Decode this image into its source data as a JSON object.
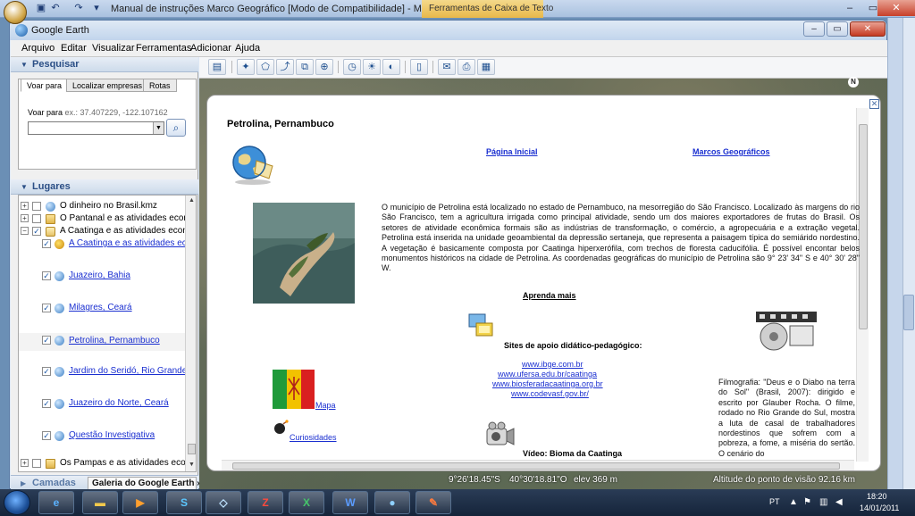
{
  "word": {
    "title": "Manual de instruções Marco Geográfico [Modo de Compatibilidade] - Microsoft Wo...",
    "tools_tab": "Ferramentas de Caixa de Texto"
  },
  "ge": {
    "title": "Google Earth",
    "menu": [
      "Arquivo",
      "Editar",
      "Visualizar",
      "Ferramentas",
      "Adicionar",
      "Ajuda"
    ]
  },
  "search": {
    "header": "Pesquisar",
    "tabs": [
      "Voar para",
      "Localizar empresas",
      "Rotas"
    ],
    "fly_label": "Voar para",
    "fly_example": "ex.: 37.407229, -122.107162",
    "input_value": ""
  },
  "places": {
    "header": "Lugares",
    "items": [
      {
        "label": "O dinheiro no Brasil.kmz"
      },
      {
        "label": "O Pantanal e as atividades econ..."
      },
      {
        "label": "A Caatinga e as atividades econ..."
      },
      {
        "label": "A Caatinga e as atividades econô"
      },
      {
        "label": "Juazeiro, Bahia"
      },
      {
        "label": "Milagres, Ceará"
      },
      {
        "label": "Petrolina, Pernambuco"
      },
      {
        "label": "Jardim do Seridó, Rio Grande do"
      },
      {
        "label": "Juazeiro do Norte, Ceará"
      },
      {
        "label": "Questão Investigativa"
      },
      {
        "label": "Os Pampas e as atividades econ..."
      }
    ]
  },
  "layers": {
    "header": "Camadas",
    "gallery": "Galeria do Google Earth  »"
  },
  "balloon": {
    "title": "Petrolina, Pernambuco",
    "home_link": "Página Inicial",
    "markers_link": "Marcos Geográficos",
    "paragraph": "O município de Petrolina está localizado no estado de Pernambuco, na mesorregião do São Francisco. Localizado às margens do rio São Francisco, tem a agricultura irrigada como principal atividade, sendo um dos maiores exportadores de frutas do Brasil. Os setores de atividade econômica formais são as indústrias de transformação, o comércio, a agropecuária e a extração vegetal. Petrolina está inserida na unidade geoambiental da depressão sertaneja, que representa a paisagem típica do semiárido nordestino. A vegetação é basicamente composta por Caatinga hiperxerófila, com trechos de floresta caducifólia. É possível encontar belos monumentos históricos na cidade de Petrolina. As coordenadas geográficas do município de Petrolina são 9° 23' 34\" S e 40° 30' 28\" W.",
    "learn_more": "Aprenda mais",
    "sites_header": "Sites de apoio didático-pedagógico:",
    "sites": [
      "www.ibge.com.br",
      "www.ufersa.edu.br/caatinga",
      "www.biosferadacaatinga.org.br",
      "www.codevasf.gov.br/"
    ],
    "film_text": "Filmografia: \"Deus e o Diabo na terra do Sol\" (Brasil, 2007): dirigido e escrito por Glauber Rocha. O filme, rodado no Rio Grande do Sul, mostra a luta de casal de trabalhadores nordestinos que sofrem com a pobreza, a fome, a miséria do sertão. O cenário do",
    "map_link": "Mapa",
    "curiosities_link": "Curiosidades",
    "video_label": "Vídeo: Bioma da Caatinga"
  },
  "status": {
    "lat": "9°26'18.45\"S",
    "lon": "40°30'18.81\"O",
    "elev": "elev  369 m",
    "alt": "Altitude do ponto de visão    92.16 km"
  },
  "taskbar": {
    "lang": "PT",
    "time": "18:20",
    "date": "14/01/2011"
  }
}
